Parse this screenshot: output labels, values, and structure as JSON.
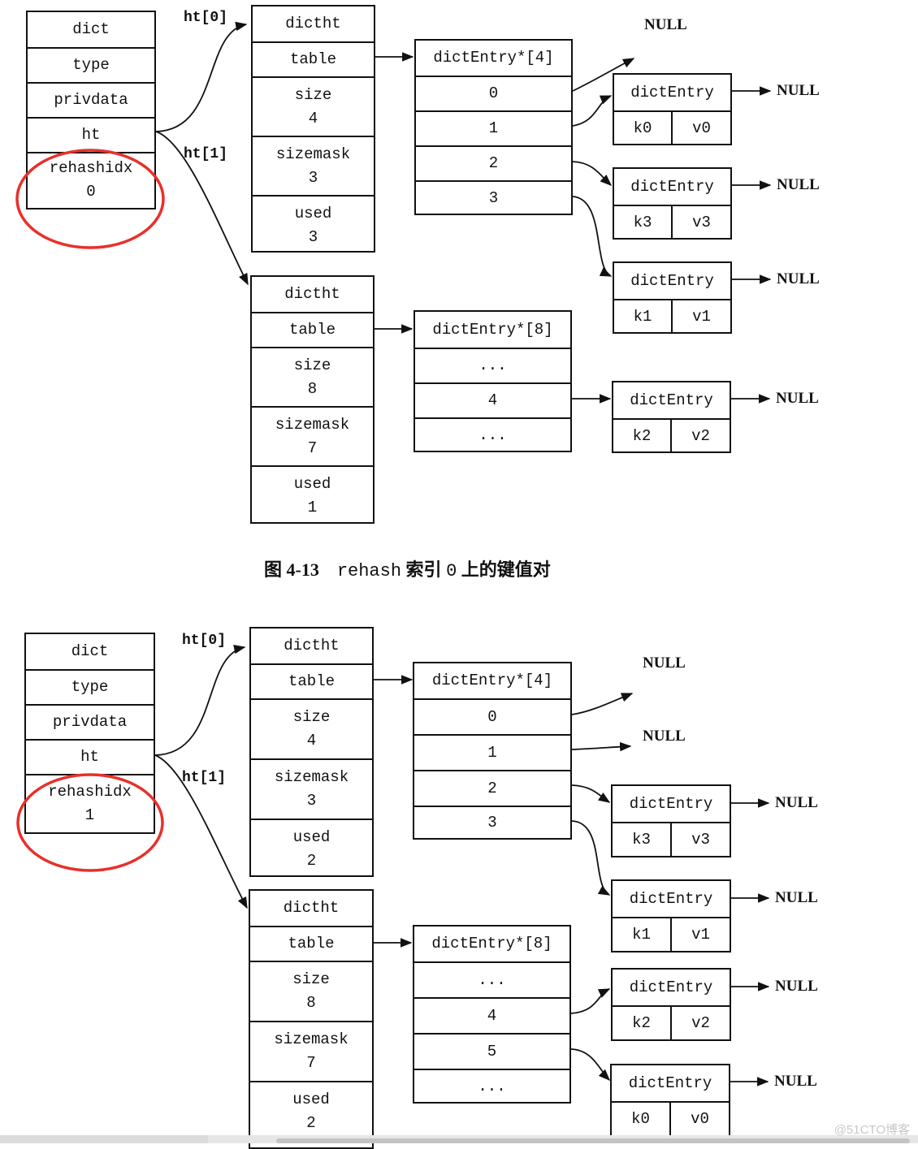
{
  "watermark": "@51CTO博客",
  "figures": [
    {
      "id": "top",
      "dict": {
        "fields": [
          "dict",
          "type",
          "privdata",
          "ht"
        ],
        "rehashidx_label": "rehashidx",
        "rehashidx_value": "0",
        "highlight_color": "#e8302a"
      },
      "ht_labels": [
        "ht[0]",
        "ht[1]"
      ],
      "dictht": [
        {
          "title": "dictht",
          "table": "table",
          "size_label": "size",
          "size": "4",
          "sizemask_label": "sizemask",
          "sizemask": "3",
          "used_label": "used",
          "used": "3"
        },
        {
          "title": "dictht",
          "table": "table",
          "size_label": "size",
          "size": "8",
          "sizemask_label": "sizemask",
          "sizemask": "7",
          "used_label": "used",
          "used": "1"
        }
      ],
      "arrays": [
        {
          "title": "dictEntry*[4]",
          "slots": [
            "0",
            "1",
            "2",
            "3"
          ]
        },
        {
          "title": "dictEntry*[8]",
          "slots": [
            "...",
            "4",
            "..."
          ]
        }
      ],
      "entries": [
        {
          "title": "dictEntry",
          "key": "k0",
          "value": "v0",
          "next": "NULL"
        },
        {
          "title": "dictEntry",
          "key": "k3",
          "value": "v3",
          "next": "NULL"
        },
        {
          "title": "dictEntry",
          "key": "k1",
          "value": "v1",
          "next": "NULL"
        },
        {
          "title": "dictEntry",
          "key": "k2",
          "value": "v2",
          "next": "NULL"
        }
      ],
      "null_labels": [
        "NULL"
      ],
      "caption": {
        "fig": "图 4-13",
        "code": "rehash",
        "text1": "索引",
        "index": "0",
        "text2": "上的键值对"
      }
    },
    {
      "id": "bottom",
      "dict": {
        "fields": [
          "dict",
          "type",
          "privdata",
          "ht"
        ],
        "rehashidx_label": "rehashidx",
        "rehashidx_value": "1",
        "highlight_color": "#e8302a"
      },
      "ht_labels": [
        "ht[0]",
        "ht[1]"
      ],
      "dictht": [
        {
          "title": "dictht",
          "table": "table",
          "size_label": "size",
          "size": "4",
          "sizemask_label": "sizemask",
          "sizemask": "3",
          "used_label": "used",
          "used": "2"
        },
        {
          "title": "dictht",
          "table": "table",
          "size_label": "size",
          "size": "8",
          "sizemask_label": "sizemask",
          "sizemask": "7",
          "used_label": "used",
          "used": "2"
        }
      ],
      "arrays": [
        {
          "title": "dictEntry*[4]",
          "slots": [
            "0",
            "1",
            "2",
            "3"
          ]
        },
        {
          "title": "dictEntry*[8]",
          "slots": [
            "...",
            "4",
            "5",
            "..."
          ]
        }
      ],
      "entries": [
        {
          "title": "dictEntry",
          "key": "k3",
          "value": "v3",
          "next": "NULL"
        },
        {
          "title": "dictEntry",
          "key": "k1",
          "value": "v1",
          "next": "NULL"
        },
        {
          "title": "dictEntry",
          "key": "k2",
          "value": "v2",
          "next": "NULL"
        },
        {
          "title": "dictEntry",
          "key": "k0",
          "value": "v0",
          "next": "NULL"
        }
      ],
      "null_labels": [
        "NULL",
        "NULL"
      ]
    }
  ]
}
